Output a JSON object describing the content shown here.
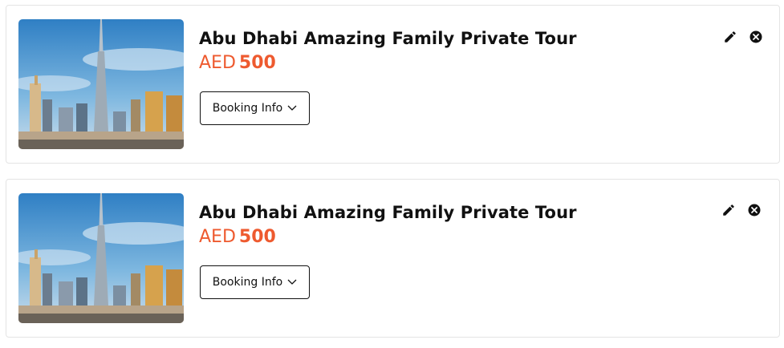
{
  "cart_items": [
    {
      "title": "Abu Dhabi Amazing Family Private Tour",
      "currency": "AED",
      "price": "500",
      "booking_label": "Booking Info",
      "image_alt": "city-skyline-image",
      "edit_icon": "pencil-icon",
      "remove_icon": "close-circle-icon"
    },
    {
      "title": "Abu Dhabi Amazing Family Private Tour",
      "currency": "AED",
      "price": "500",
      "booking_label": "Booking Info",
      "image_alt": "city-skyline-image",
      "edit_icon": "pencil-icon",
      "remove_icon": "close-circle-icon"
    }
  ],
  "colors": {
    "price": "#ee5a2f",
    "text": "#111111",
    "border": "#e4e4e4"
  }
}
